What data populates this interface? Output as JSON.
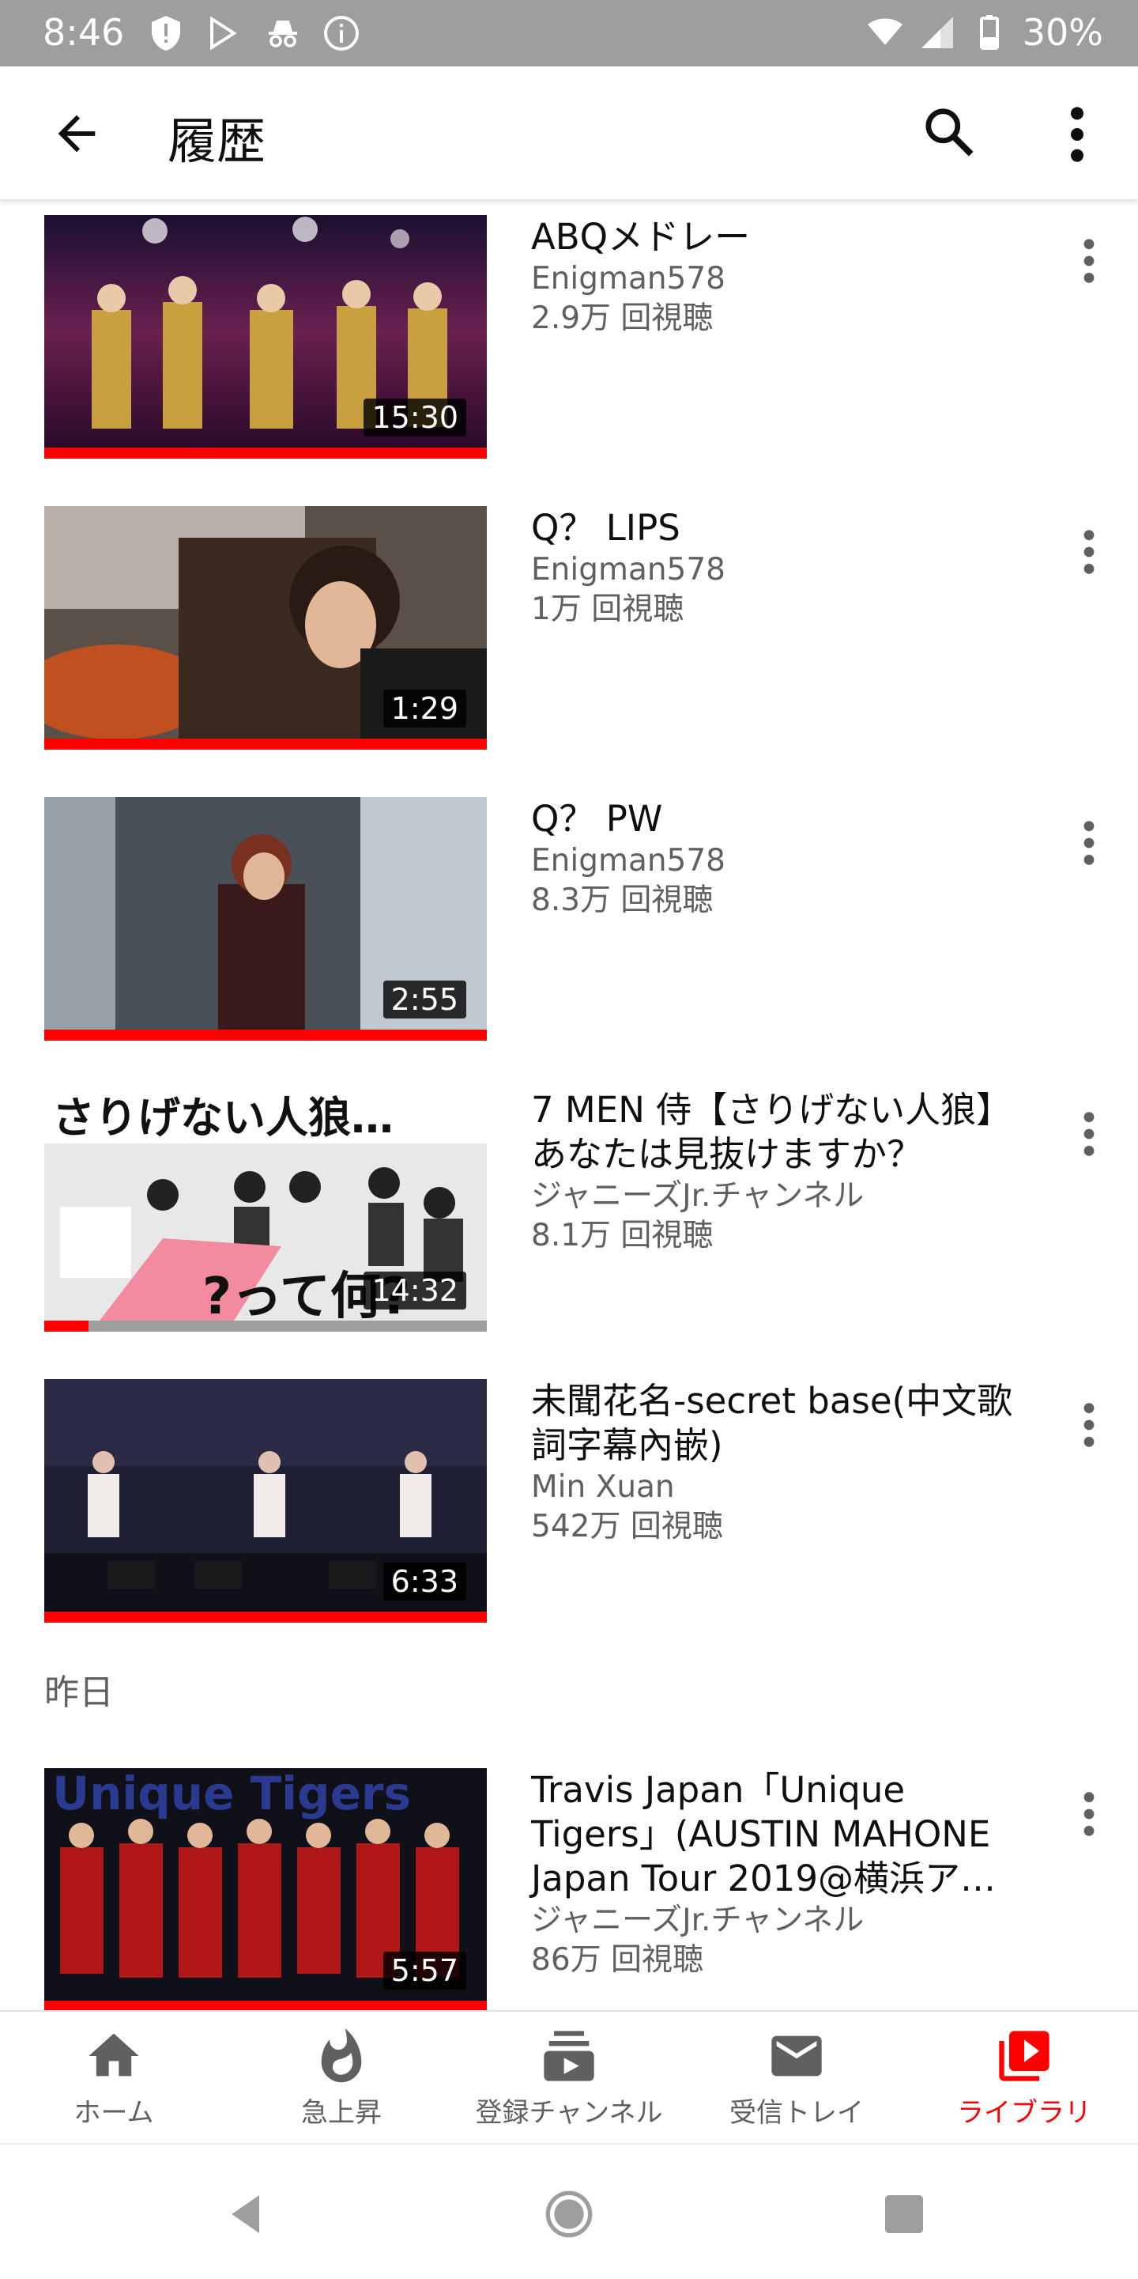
{
  "status_bar": {
    "time": "8:46",
    "battery": "30%"
  },
  "app_bar": {
    "title": "履歴"
  },
  "videos": [
    {
      "title": "ABQメドレー",
      "channel": "Enigman578",
      "views": "2.9万 回視聴",
      "duration": "15:30",
      "progress": 1.0
    },
    {
      "title": "Q？ LIPS",
      "channel": "Enigman578",
      "views": "1万 回視聴",
      "duration": "1:29",
      "progress": 1.0
    },
    {
      "title": "Q？ PW",
      "channel": "Enigman578",
      "views": "8.3万 回視聴",
      "duration": "2:55",
      "progress": 1.0
    },
    {
      "title": "7 MEN 侍【さりげない人狼】あなたは見抜けますか？",
      "channel": "ジャニーズJr.チャンネル",
      "views": "8.1万 回視聴",
      "duration": "14:32",
      "progress": 0.1,
      "thumb_text": "さりげない人狼…",
      "thumb_text2": "?って何?"
    },
    {
      "title": "未聞花名-secret base(中文歌詞字幕內嵌)",
      "channel": "Min Xuan",
      "views": "542万 回視聴",
      "duration": "6:33",
      "progress": 1.0
    },
    {
      "title": "Travis Japan「Unique Tigers」(AUSTIN MAHONE Japan Tour 2019@横浜ア…",
      "channel": "ジャニーズJr.チャンネル",
      "views": "86万 回視聴",
      "duration": "5:57",
      "progress": 1.0,
      "thumb_text": "Unique Tigers"
    }
  ],
  "section_yesterday": "昨日",
  "bottom_nav": [
    {
      "label": "ホーム",
      "icon": "home-icon"
    },
    {
      "label": "急上昇",
      "icon": "trending-icon"
    },
    {
      "label": "登録チャンネル",
      "icon": "subscriptions-icon"
    },
    {
      "label": "受信トレイ",
      "icon": "inbox-icon"
    },
    {
      "label": "ライブラリ",
      "icon": "library-icon",
      "active": true
    }
  ],
  "colors": {
    "accent": "#ff0000",
    "status_bar": "#9e9e9e",
    "meta_text": "#606060"
  }
}
